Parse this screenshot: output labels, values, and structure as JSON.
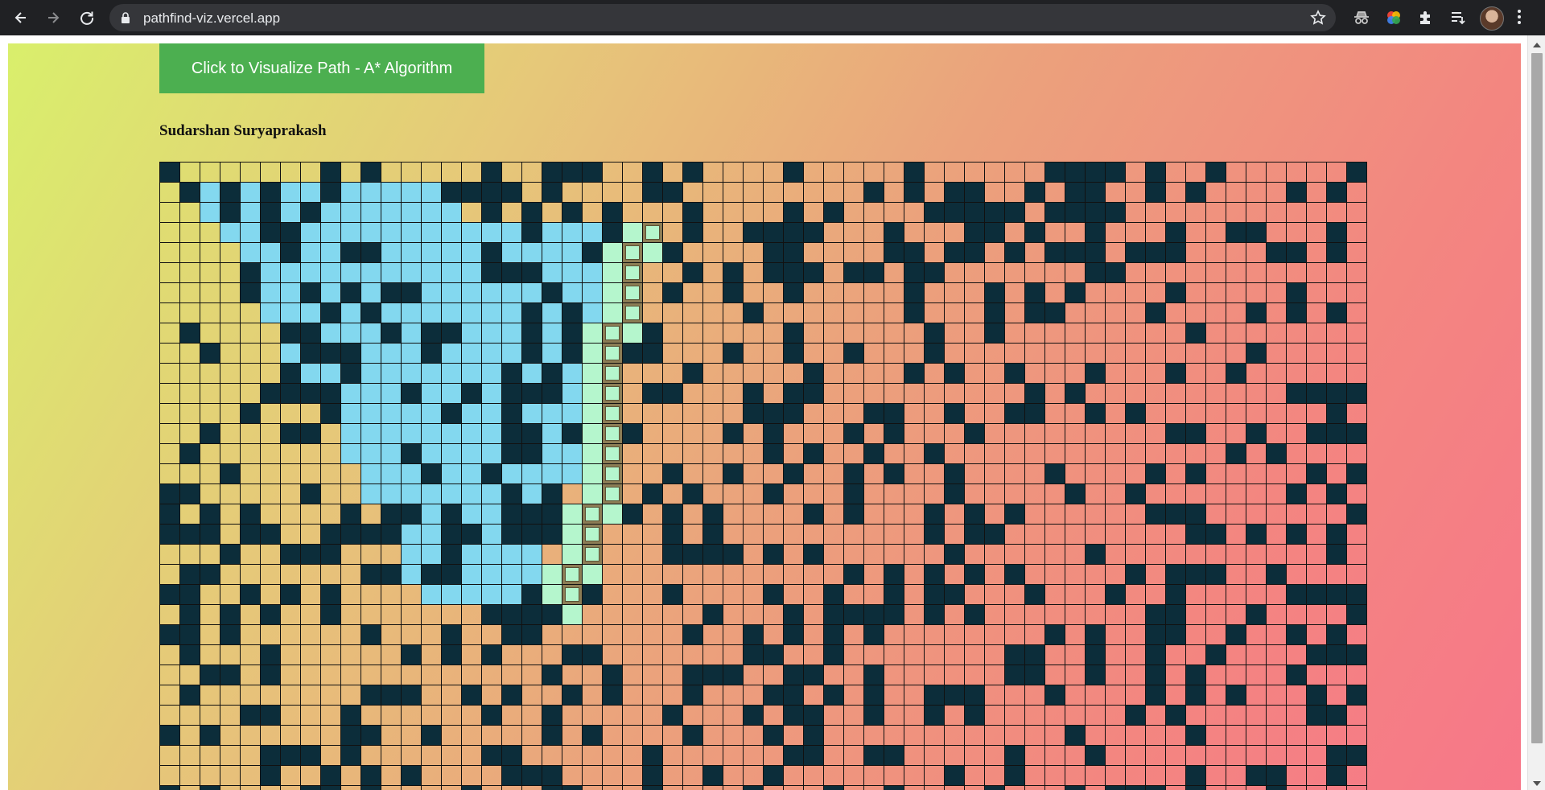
{
  "browser": {
    "url": "pathfind-viz.vercel.app",
    "icons": [
      "back-icon",
      "forward-icon",
      "reload-icon",
      "lock-icon",
      "star-icon",
      "incognito-extension-icon",
      "color-extension-icon",
      "puzzle-extensions-icon",
      "reading-list-icon",
      "avatar",
      "menu-dots-icon"
    ]
  },
  "page": {
    "button_label": "Click to Visualize Path - A* Algorithm",
    "author": "Sudarshan Suryaprakash"
  },
  "grid": {
    "cols": 60,
    "rows": 32,
    "wall_density": 0.28,
    "colors": {
      "wall": "#0c2d3a",
      "visited": "#83d8ef",
      "frontier": "#b5f6cd",
      "path": "#8c7d55",
      "border": "#111111"
    },
    "start": {
      "col": 20,
      "row": 21
    },
    "goal": {
      "col": 24,
      "row": 3
    }
  }
}
